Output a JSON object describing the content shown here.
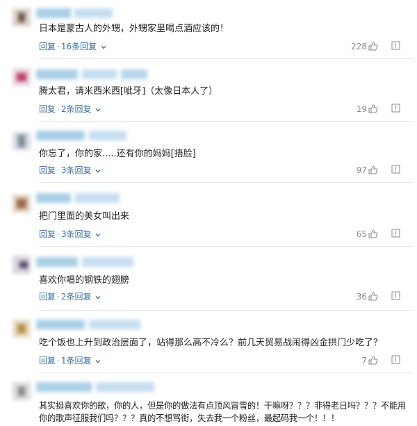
{
  "reply_label": "回复",
  "separator": "·",
  "comments": [
    {
      "text": "日本是蒙古人的外甥，外甥家里喝点酒应该的！",
      "replies": "16条回复",
      "likes": "228"
    },
    {
      "text": "腾太君，请米西米西[呲牙]（太像日本人了）",
      "replies": "2条回复",
      "likes": "19"
    },
    {
      "text": "你忘了，你的家.....还有你的妈妈[捂脸]",
      "replies": "3条回复",
      "likes": "97"
    },
    {
      "text": "把门里面的美女叫出来",
      "replies": "3条回复",
      "likes": "65"
    },
    {
      "text": "喜欢你唱的钢铁的翅膀",
      "replies": "2条回复",
      "likes": "36"
    },
    {
      "text": "吃个饭也上升到政治层面了，站得那么高不冷么？前几天贸易战闹得凶金拱门少吃了？",
      "replies": "1条回复",
      "likes": "7"
    },
    {
      "text": "其实挺喜欢你的歌，你的人，但是你的做法有点顶风冒雪的！干嘛呀？？？非得老日吗？？？不能用",
      "text2": "你的歌声征服我们吗？？？真的不想骂街，失去我一个粉丝，最起码我一个！！！"
    }
  ],
  "colors": {
    "link": "#3b6ea8",
    "muted": "#8a8a8a",
    "text": "#222222"
  },
  "icons": [
    "avatar",
    "thumbs-up-icon",
    "report-icon",
    "chevron-down-icon"
  ]
}
